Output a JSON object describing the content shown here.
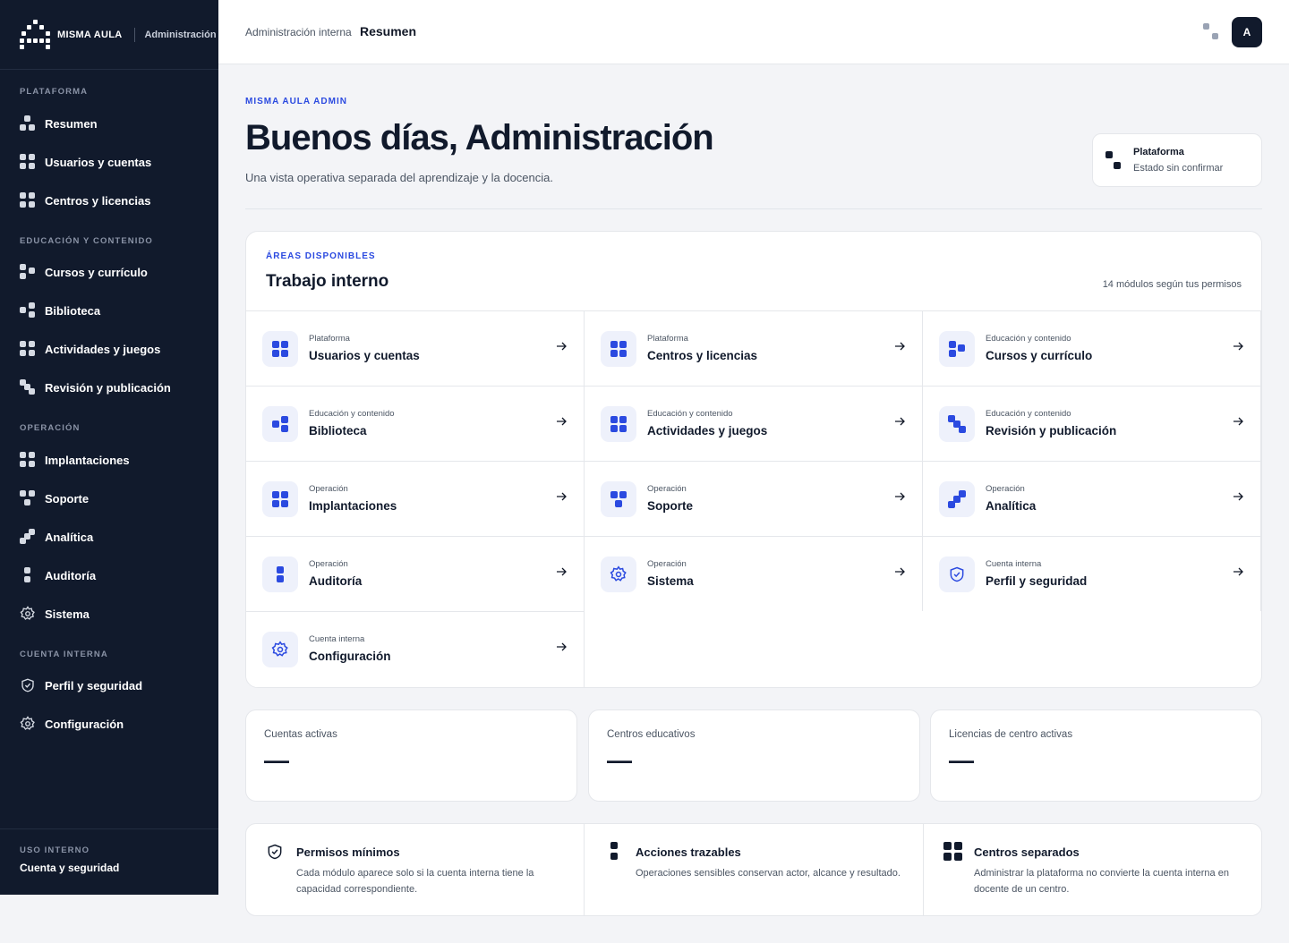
{
  "brand": {
    "name": "MISMA AULA",
    "section": "Administración"
  },
  "sidebar": {
    "sections": [
      {
        "title": "PLATAFORMA"
      },
      {
        "title": "EDUCACIÓN Y CONTENIDO"
      },
      {
        "title": "OPERACIÓN"
      },
      {
        "title": "CUENTA INTERNA"
      }
    ],
    "items": [
      {
        "label": "Resumen",
        "icon": "dots-icon"
      },
      {
        "label": "Usuarios y cuentas",
        "icon": "grid-icon"
      },
      {
        "label": "Centros y licencias",
        "icon": "grid-icon"
      },
      {
        "label": "Cursos y currículo",
        "icon": "dots-icon"
      },
      {
        "label": "Biblioteca",
        "icon": "dots-icon"
      },
      {
        "label": "Actividades y juegos",
        "icon": "grid-icon"
      },
      {
        "label": "Revisión y publicación",
        "icon": "steps-icon"
      },
      {
        "label": "Implantaciones",
        "icon": "grid-icon"
      },
      {
        "label": "Soporte",
        "icon": "dots-icon"
      },
      {
        "label": "Analítica",
        "icon": "steps-icon"
      },
      {
        "label": "Auditoría",
        "icon": "stack-icon"
      },
      {
        "label": "Sistema",
        "icon": "gear-icon"
      },
      {
        "label": "Perfil y seguridad",
        "icon": "shield-icon"
      },
      {
        "label": "Configuración",
        "icon": "gear-icon"
      }
    ],
    "footer": {
      "title": "USO INTERNO",
      "subtitle": "Cuenta y seguridad"
    }
  },
  "topbar": {
    "breadcrumb_parent": "Administración interna",
    "breadcrumb_current": "Resumen",
    "avatar_initial": "A"
  },
  "header": {
    "eyebrow": "MISMA AULA ADMIN",
    "title": "Buenos días, Administración",
    "subtitle": "Una vista operativa separada del aprendizaje y la docencia.",
    "status": {
      "title": "Plataforma",
      "text": "Estado sin confirmar"
    }
  },
  "modules_panel": {
    "eyebrow": "ÁREAS DISPONIBLES",
    "title": "Trabajo interno",
    "count_text": "14 módulos según tus permisos",
    "modules": [
      {
        "category": "Plataforma",
        "name": "Usuarios y cuentas",
        "icon": "grid-icon"
      },
      {
        "category": "Plataforma",
        "name": "Centros y licencias",
        "icon": "grid-icon"
      },
      {
        "category": "Educación y contenido",
        "name": "Cursos y currículo",
        "icon": "dots-icon"
      },
      {
        "category": "Educación y contenido",
        "name": "Biblioteca",
        "icon": "dots-icon"
      },
      {
        "category": "Educación y contenido",
        "name": "Actividades y juegos",
        "icon": "grid-icon"
      },
      {
        "category": "Educación y contenido",
        "name": "Revisión y publicación",
        "icon": "steps-icon"
      },
      {
        "category": "Operación",
        "name": "Implantaciones",
        "icon": "grid-icon"
      },
      {
        "category": "Operación",
        "name": "Soporte",
        "icon": "dots-icon"
      },
      {
        "category": "Operación",
        "name": "Analítica",
        "icon": "steps-icon"
      },
      {
        "category": "Operación",
        "name": "Auditoría",
        "icon": "stack-icon"
      },
      {
        "category": "Operación",
        "name": "Sistema",
        "icon": "gear-icon"
      },
      {
        "category": "Cuenta interna",
        "name": "Perfil y seguridad",
        "icon": "shield-icon"
      },
      {
        "category": "Cuenta interna",
        "name": "Configuración",
        "icon": "gear-icon"
      }
    ]
  },
  "stats": [
    {
      "label": "Cuentas activas",
      "value": "—"
    },
    {
      "label": "Centros educativos",
      "value": "—"
    },
    {
      "label": "Licencias de centro activas",
      "value": "—"
    }
  ],
  "principles": [
    {
      "title": "Permisos mínimos",
      "text": "Cada módulo aparece solo si la cuenta interna tiene la capacidad correspondiente.",
      "icon": "shield-icon"
    },
    {
      "title": "Acciones trazables",
      "text": "Operaciones sensibles conservan actor, alcance y resultado.",
      "icon": "stack-icon"
    },
    {
      "title": "Centros separados",
      "text": "Administrar la plataforma no convierte la cuenta interna en docente de un centro.",
      "icon": "grid-icon"
    }
  ],
  "colors": {
    "sidebar_bg": "#111a2c",
    "accent": "#2b4ae0",
    "page_bg": "#f3f4f7"
  }
}
